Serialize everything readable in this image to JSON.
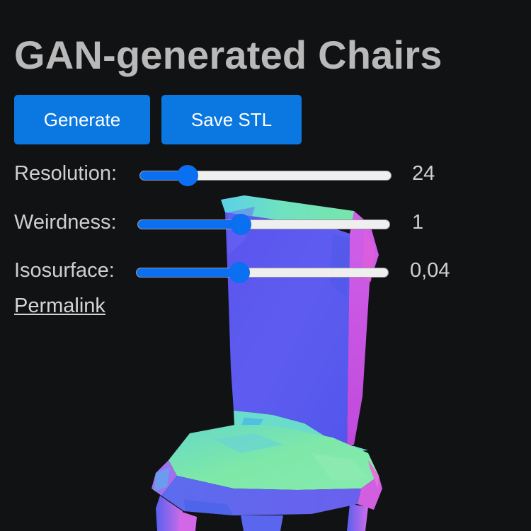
{
  "page": {
    "title": "GAN-generated Chairs"
  },
  "buttons": {
    "generate_label": "Generate",
    "save_label": "Save STL"
  },
  "controls": [
    {
      "label": "Resolution:",
      "value": "24",
      "fraction": 0.19
    },
    {
      "label": "Weirdness:",
      "value": "1",
      "fraction": 0.41
    },
    {
      "label": "Isosurface:",
      "value": "0,04",
      "fraction": 0.41
    }
  ],
  "links": {
    "permalink_label": "Permalink"
  },
  "colors": {
    "background": "#111214",
    "accent": "#0a78e0",
    "text": "#cfcfcf",
    "title": "#b9b9b9"
  }
}
